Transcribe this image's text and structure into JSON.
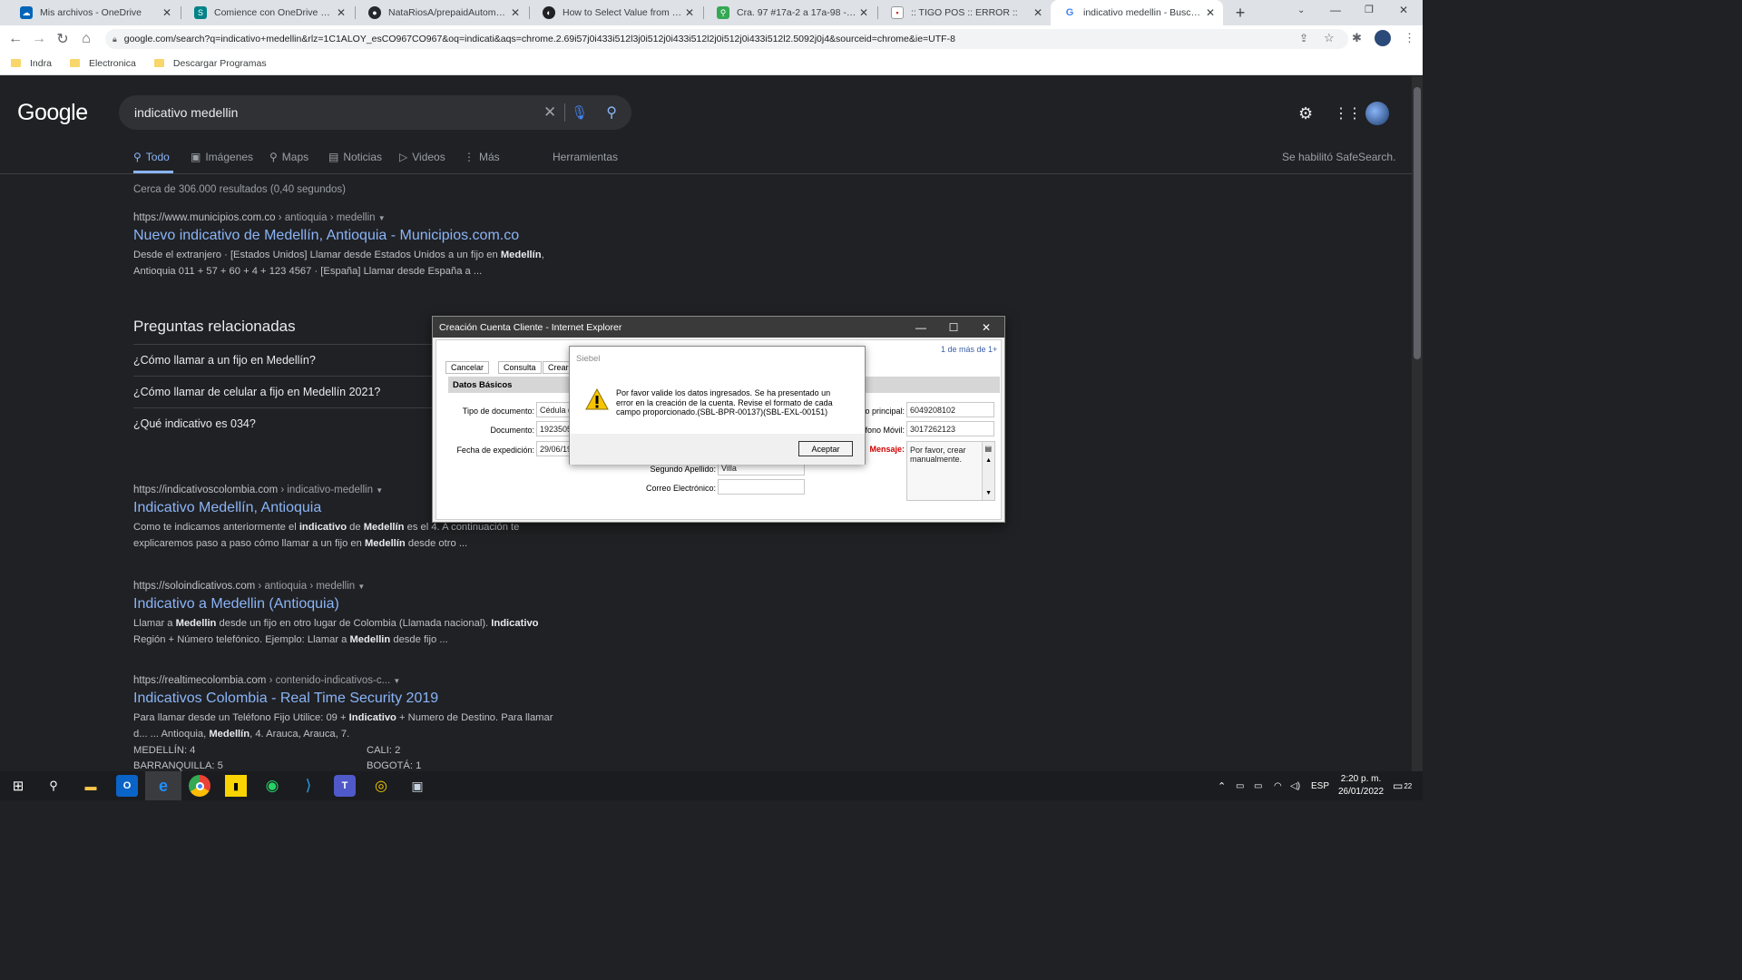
{
  "browser": {
    "tabs": [
      {
        "title": "Mis archivos - OneDrive",
        "icon": "onedrive-icon",
        "color": "#0364b8"
      },
      {
        "title": "Comience con OneDrive para la",
        "icon": "sharepoint-icon",
        "color": "#038387"
      },
      {
        "title": "NataRiosA/prepaidAutomation",
        "icon": "github-icon",
        "color": "#24292e"
      },
      {
        "title": "How to Select Value from DropD",
        "icon": "site-icon",
        "color": "#202124"
      },
      {
        "title": "Cra. 97 #17a-2 a 17a-98 - Goog",
        "icon": "maps-icon",
        "color": "#34a853"
      },
      {
        "title": ":: TIGO POS :: ERROR ::",
        "icon": "page-icon",
        "color": "#d93025"
      },
      {
        "title": "indicativo medellin - Buscar con",
        "icon": "google-icon",
        "color": "#4285f4"
      }
    ],
    "new_tab": "+",
    "url": "google.com/search?q=indicativo+medellin&rlz=1C1ALOY_esCO967CO967&oq=indicati&aqs=chrome.2.69i57j0i433i512l3j0i512j0i433i512l2j0i512j0i433i512l2.5092j0j4&sourceid=chrome&ie=UTF-8",
    "bookmarks": [
      "Indra",
      "Electronica",
      "Descargar Programas"
    ]
  },
  "google": {
    "logo": "Google",
    "query": "indicativo medellin",
    "tabs": [
      "Todo",
      "Imágenes",
      "Maps",
      "Noticias",
      "Videos",
      "Más"
    ],
    "tools": "Herramientas",
    "safesearch": "Se habilitó SafeSearch.",
    "stats": "Cerca de 306.000 resultados (0,40 segundos)",
    "result1": {
      "url": "https://www.municipios.com.co",
      "crumb": " › antioquia › medellin",
      "title": "Nuevo indicativo de Medellín, Antioquia - Municipios.com.co",
      "s1": "Desde el extranjero · [Estados Unidos] Llamar desde Estados Unidos a un fijo en ",
      "s1b": "Medellín",
      "s1c": ",",
      "s2": "Antioquia 011 + 57 + 60 + 4 + 123 4567 · [España] Llamar desde España a ..."
    },
    "paa_title": "Preguntas relacionadas",
    "paa": [
      "¿Cómo llamar a un fijo en Medellín?",
      "¿Cómo llamar de celular a fijo en Medellín 2021?",
      "¿Qué indicativo es 034?"
    ],
    "result2": {
      "url": "https://indicativoscolombia.com",
      "crumb": " › indicativo-medellin",
      "title": "Indicativo Medellín, Antioquia",
      "s1": "Como te indicamos anteriormente el ",
      "s1b": "indicativo",
      "s1c": " de ",
      "s1d": "Medellín",
      "s1e": " es el 4. A continuación te",
      "s2": "explicaremos paso a paso cómo llamar a un fijo en ",
      "s2b": "Medellín",
      "s2c": " desde otro ..."
    },
    "result3": {
      "url": "https://soloindicativos.com",
      "crumb": " › antioquia › medellin",
      "title": "Indicativo a Medellin (Antioquia)",
      "s1": "Llamar a ",
      "s1b": "Medellin",
      "s1c": " desde un fijo en otro lugar de Colombia (Llamada nacional). ",
      "s1d": "Indicativo",
      "s2": "Región + Número telefónico. Ejemplo: Llamar a ",
      "s2b": "Medellin",
      "s2c": " desde fijo ..."
    },
    "result4": {
      "url": "https://realtimecolombia.com",
      "crumb": " › contenido-indicativos-c...",
      "title": "Indicativos Colombia - Real Time Security 2019",
      "s1": "Para llamar desde un Teléfono Fijo Utilice: 09 + ",
      "s1b": "Indicativo",
      "s1c": " + Numero de Destino. Para llamar",
      "s2": "d... ... Antioquia, ",
      "s2b": "Medellín",
      "s2c": ", 4. Arauca, Arauca, 7.",
      "t1a": "MEDELLÍN: 4",
      "t1b": "CALI: 2",
      "t2a": "BARRANQUILLA: 5",
      "t2b": "BOGOTÁ: 1"
    }
  },
  "ie_window": {
    "title": "Creación Cuenta Cliente - Internet Explorer",
    "record_count": "1 de más de 1+",
    "buttons": [
      "Cancelar",
      "Consulta",
      "Crear"
    ],
    "section": "Datos Básicos",
    "fields": {
      "tipo_doc_label": "Tipo de documento:",
      "tipo_doc_value": "Cédula d",
      "documento_label": "Documento:",
      "documento_value": "1923505",
      "fecha_label": "Fecha de expedición:",
      "fecha_value": "29/06/19",
      "segundo_apellido_label": "Segundo Apellido:",
      "segundo_apellido_value": "Villa",
      "correo_label": "Correo Electrónico:",
      "correo_value": "",
      "tel_principal_label": "o principal:",
      "tel_principal_value": "6049208102",
      "tel_movil_label": "fono Móvil:",
      "tel_movil_value": "3017262123",
      "mensaje_label": "Mensaje:",
      "mensaje_value": "Por favor, crear manualmente."
    }
  },
  "siebel_dialog": {
    "title": "Siebel",
    "message": "Por favor valide los datos ingresados. Se ha presentado un error en la creación de la cuenta. Revise el formato de cada campo proporcionado.(SBL-BPR-00137)(SBL-EXL-00151)",
    "ok": "Aceptar"
  },
  "taskbar": {
    "lang": "ESP",
    "time": "2:20 p. m.",
    "date": "26/01/2022",
    "notifications": "22"
  }
}
